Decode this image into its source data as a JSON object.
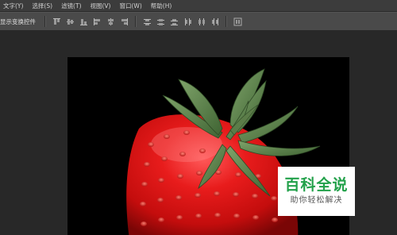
{
  "menubar": {
    "items": [
      {
        "label": "文字(Y)"
      },
      {
        "label": "选择(S)"
      },
      {
        "label": "滤镜(T)"
      },
      {
        "label": "视图(V)"
      },
      {
        "label": "窗口(W)"
      },
      {
        "label": "帮助(H)"
      }
    ]
  },
  "options": {
    "show_transform_controls_label": "显示变换控件"
  },
  "canvas": {
    "background": "#000000",
    "image_subject": "strawberry"
  },
  "watermark": {
    "title": "百科全说",
    "subtitle": "助你轻松解决",
    "title_color": "#22a14a"
  },
  "colors": {
    "menubar_bg": "#3c3c3c",
    "optionsbar_bg": "#4a4a4a",
    "workspace_bg": "#282828"
  }
}
